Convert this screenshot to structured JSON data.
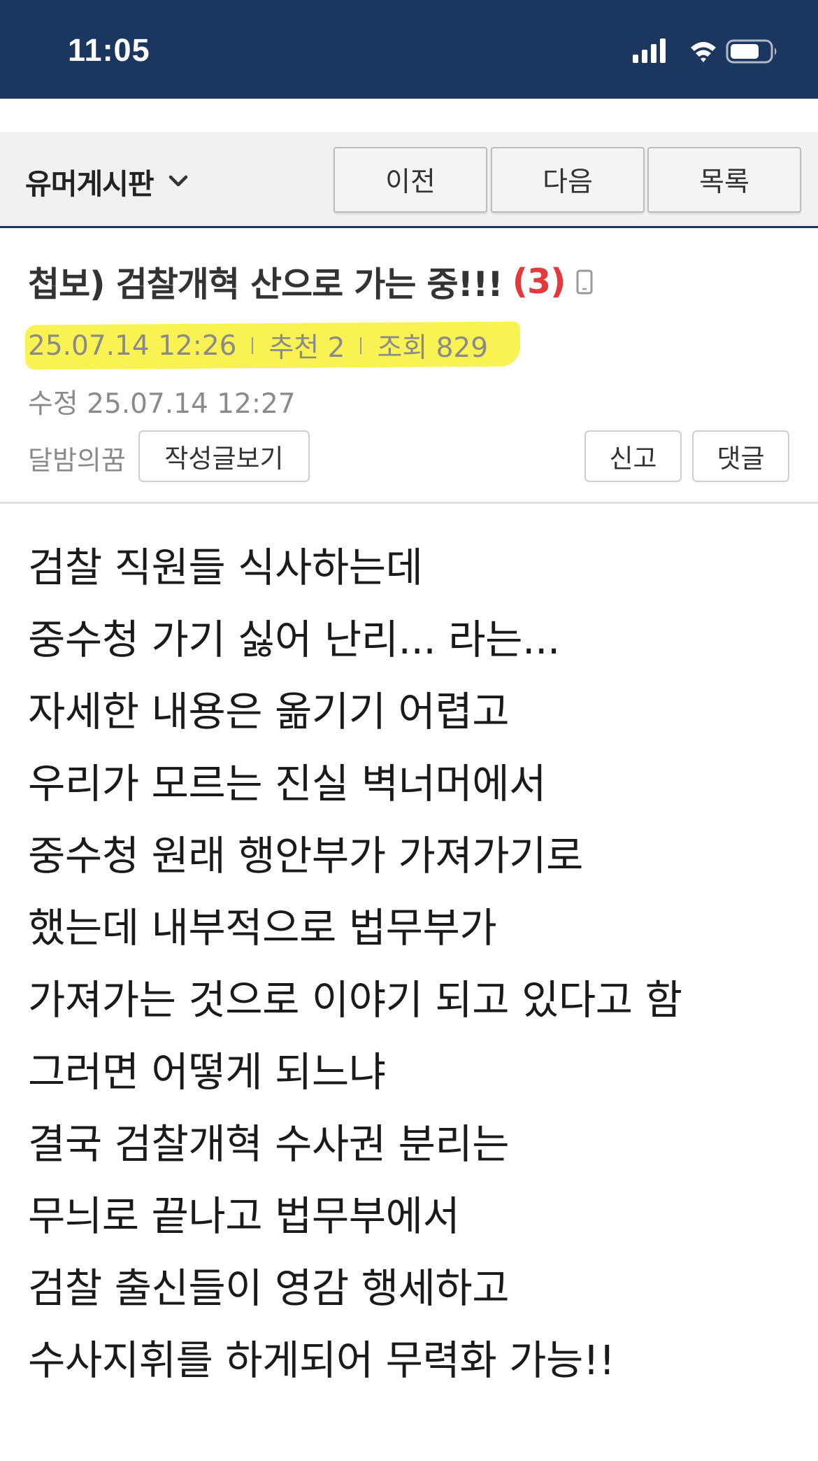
{
  "status_bar": {
    "time": "11:05"
  },
  "board": {
    "title": "유머게시판",
    "buttons": {
      "prev": "이전",
      "next": "다음",
      "list": "목록"
    }
  },
  "post": {
    "title": "첩보) 검찰개혁 산으로 가는 중!!!",
    "comment_count": "(3)",
    "date": "25.07.14  12:26",
    "recommend": "추천 2",
    "views": "조회 829",
    "edited": "수정 25.07.14  12:27",
    "author": "달밤의꿈",
    "author_posts_button": "작성글보기",
    "report_button": "신고",
    "comment_button": "댓글",
    "body_lines": [
      "검찰 직원들 식사하는데",
      "중수청 가기 싫어 난리... 라는...",
      "자세한 내용은 옮기기 어렵고",
      "우리가 모르는 진실 벽너머에서",
      "중수청 원래 행안부가 가져가기로",
      "했는데 내부적으로 법무부가",
      "가져가는 것으로 이야기 되고 있다고 함",
      "그러면 어떻게 되느냐",
      "결국 검찰개혁 수사권 분리는",
      "무늬로 끝나고 법무부에서",
      "검찰 출신들이 영감 행세하고",
      "수사지휘를 하게되어 무력화 가능!!"
    ]
  },
  "colors": {
    "status_bar_bg": "#1b375f",
    "comment_count": "#e4393c",
    "highlight": "#f8f252"
  },
  "icons": {
    "signal": "signal-bars-icon",
    "wifi": "wifi-icon",
    "battery": "battery-icon",
    "chevron": "chevron-down-icon",
    "mobile": "mobile-phone-icon"
  }
}
